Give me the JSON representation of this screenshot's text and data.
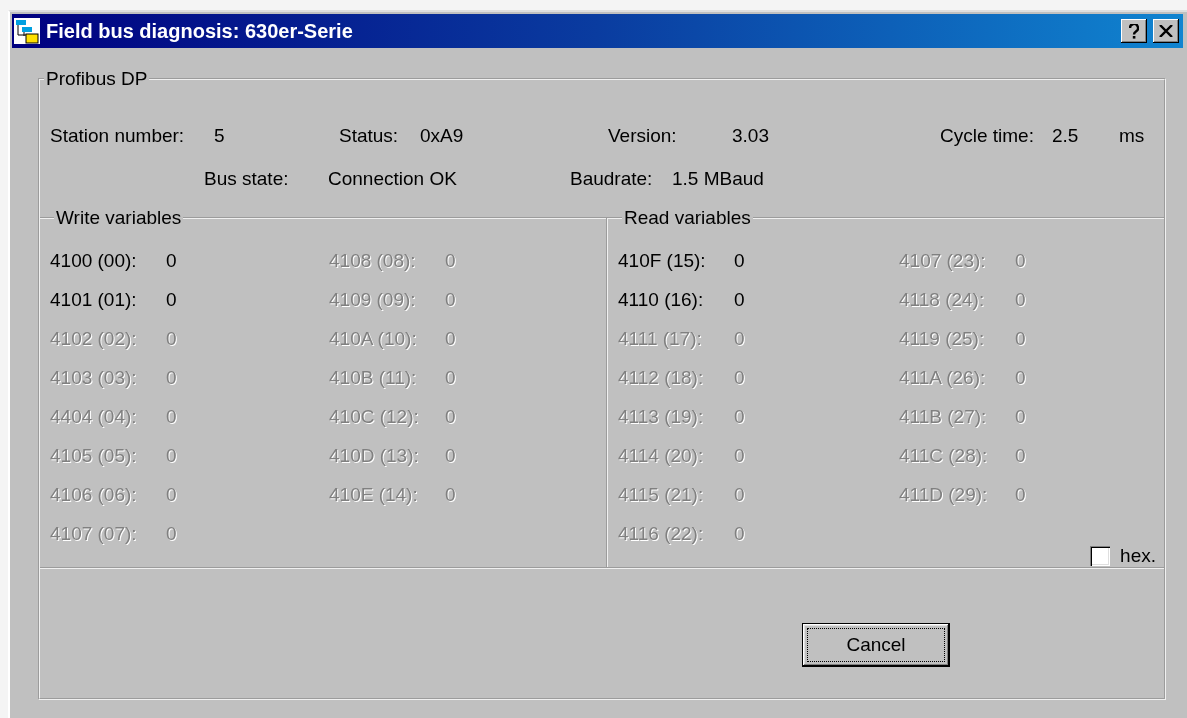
{
  "window": {
    "title": "Field bus diagnosis: 630er-Serie"
  },
  "group": {
    "title": "Profibus DP"
  },
  "info_rows": [
    [
      {
        "label": "Station number:",
        "value": "5"
      },
      {
        "label": "Status:",
        "value": "0xA9"
      },
      {
        "label": "Version:",
        "value": "3.03"
      },
      {
        "label": "Cycle time:",
        "value": "2.5",
        "unit": "ms"
      }
    ],
    [
      {
        "label": "Bus state:",
        "value": "Connection OK"
      },
      {
        "label": "Baudrate:",
        "value": "1.5 MBaud"
      }
    ]
  ],
  "write_variables": {
    "title": "Write variables",
    "columns": [
      [
        {
          "label": "4100 (00):",
          "value": "0",
          "disabled": false
        },
        {
          "label": "4101 (01):",
          "value": "0",
          "disabled": false
        },
        {
          "label": "4102 (02):",
          "value": "0",
          "disabled": true
        },
        {
          "label": "4103 (03):",
          "value": "0",
          "disabled": true
        },
        {
          "label": "4404 (04):",
          "value": "0",
          "disabled": true
        },
        {
          "label": "4105 (05):",
          "value": "0",
          "disabled": true
        },
        {
          "label": "4106 (06):",
          "value": "0",
          "disabled": true
        },
        {
          "label": "4107 (07):",
          "value": "0",
          "disabled": true
        }
      ],
      [
        {
          "label": "4108 (08):",
          "value": "0",
          "disabled": true
        },
        {
          "label": "4109 (09):",
          "value": "0",
          "disabled": true
        },
        {
          "label": "410A (10):",
          "value": "0",
          "disabled": true
        },
        {
          "label": "410B (11):",
          "value": "0",
          "disabled": true
        },
        {
          "label": "410C (12):",
          "value": "0",
          "disabled": true
        },
        {
          "label": "410D (13):",
          "value": "0",
          "disabled": true
        },
        {
          "label": "410E (14):",
          "value": "0",
          "disabled": true
        }
      ]
    ]
  },
  "read_variables": {
    "title": "Read variables",
    "columns": [
      [
        {
          "label": "410F (15):",
          "value": "0",
          "disabled": false
        },
        {
          "label": "4110 (16):",
          "value": "0",
          "disabled": false
        },
        {
          "label": "4111 (17):",
          "value": "0",
          "disabled": true
        },
        {
          "label": "4112 (18):",
          "value": "0",
          "disabled": true
        },
        {
          "label": "4113 (19):",
          "value": "0",
          "disabled": true
        },
        {
          "label": "4114 (20):",
          "value": "0",
          "disabled": true
        },
        {
          "label": "4115 (21):",
          "value": "0",
          "disabled": true
        },
        {
          "label": "4116 (22):",
          "value": "0",
          "disabled": true
        }
      ],
      [
        {
          "label": "4107 (23):",
          "value": "0",
          "disabled": true
        },
        {
          "label": "4118 (24):",
          "value": "0",
          "disabled": true
        },
        {
          "label": "4119 (25):",
          "value": "0",
          "disabled": true
        },
        {
          "label": "411A (26):",
          "value": "0",
          "disabled": true
        },
        {
          "label": "411B (27):",
          "value": "0",
          "disabled": true
        },
        {
          "label": "411C (28):",
          "value": "0",
          "disabled": true
        },
        {
          "label": "411D (29):",
          "value": "0",
          "disabled": true
        }
      ]
    ]
  },
  "hex_checkbox": {
    "label": "hex.",
    "checked": false
  },
  "buttons": [
    {
      "label": "Cancel",
      "default": true
    }
  ]
}
